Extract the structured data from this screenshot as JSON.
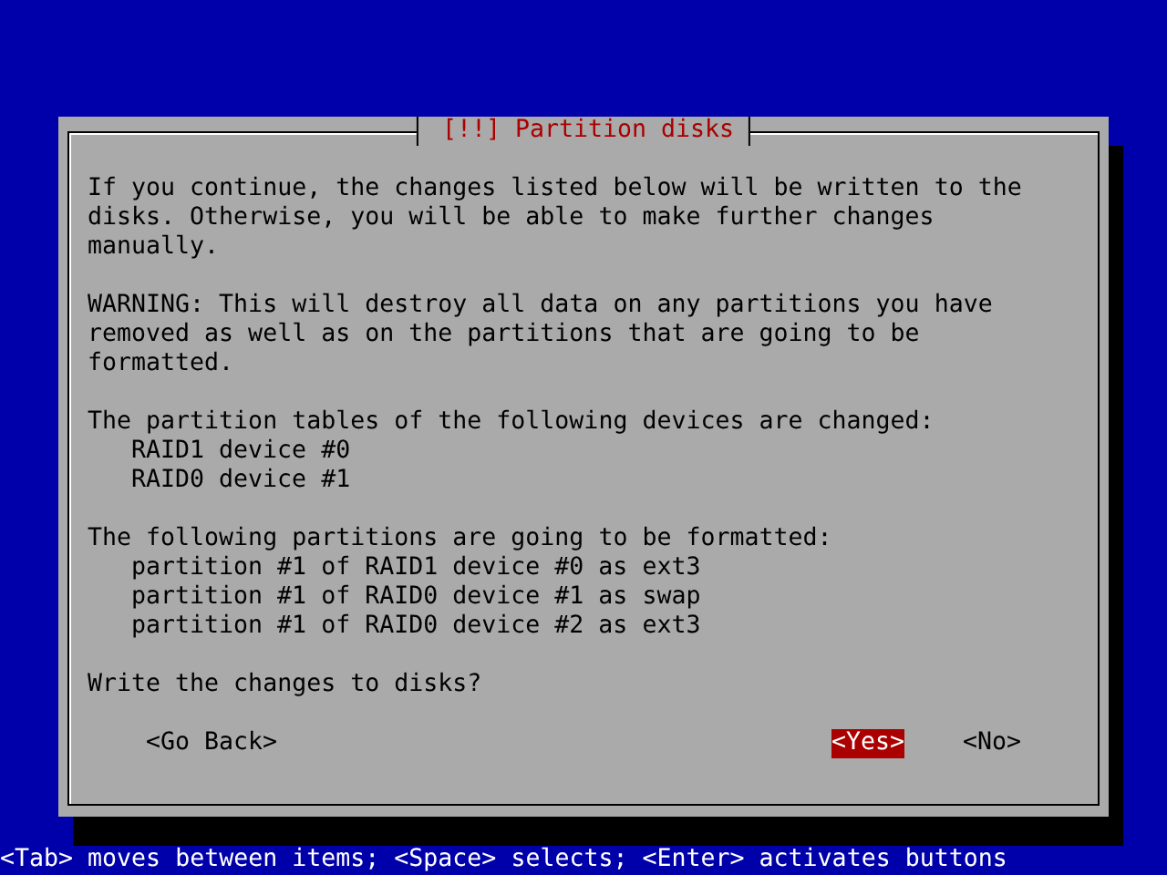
{
  "dialog": {
    "title": "[!!] Partition disks",
    "blocks": [
      {
        "kind": "paragraph",
        "text": "If you continue, the changes listed below will be written to the disks. Otherwise, you will be able to make further changes manually."
      },
      {
        "kind": "paragraph",
        "text": "WARNING: This will destroy all data on any partitions you have removed as well as on the partitions that are going to be formatted."
      },
      {
        "kind": "list",
        "heading": "The partition tables of the following devices are changed:",
        "items": [
          "RAID1 device #0",
          "RAID0 device #1"
        ]
      },
      {
        "kind": "list",
        "heading": "The following partitions are going to be formatted:",
        "items": [
          "partition #1 of RAID1 device #0 as ext3",
          "partition #1 of RAID0 device #1 as swap",
          "partition #1 of RAID0 device #2 as ext3"
        ]
      },
      {
        "kind": "paragraph",
        "text": "Write the changes to disks?"
      }
    ],
    "buttons": [
      {
        "label": "<Go Back>",
        "selected": false,
        "kind": "back"
      },
      {
        "label": "<Yes>",
        "selected": true,
        "kind": "answer"
      },
      {
        "label": "<No>",
        "selected": false,
        "kind": "answer"
      }
    ]
  },
  "status_bar": "<Tab> moves between items; <Space> selects; <Enter> activates buttons"
}
